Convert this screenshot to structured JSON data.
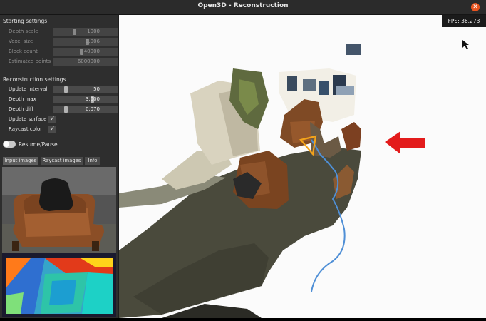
{
  "window": {
    "title": "Open3D - Reconstruction"
  },
  "starting_settings": {
    "heading": "Starting settings",
    "rows": [
      {
        "label": "Depth scale",
        "value": "1000",
        "handle": 0.3
      },
      {
        "label": "Voxel size",
        "value": "0.006",
        "handle": 0.48
      },
      {
        "label": "Block count",
        "value": "40000",
        "handle": 0.4
      },
      {
        "label": "Estimated points",
        "value": "6000000",
        "handle": 0.98
      }
    ]
  },
  "reconstruction_settings": {
    "heading": "Reconstruction settings",
    "sliders": [
      {
        "label": "Update interval",
        "value": "50",
        "handle": 0.18
      },
      {
        "label": "Depth max",
        "value": "3.000",
        "handle": 0.55
      },
      {
        "label": "Depth diff",
        "value": "0.070",
        "handle": 0.18
      }
    ],
    "checks": [
      {
        "label": "Update surface",
        "checked": true
      },
      {
        "label": "Raycast color",
        "checked": true
      }
    ]
  },
  "resume": {
    "label": "Resume/Pause"
  },
  "tabs": [
    "Input images",
    "Raycast images",
    "Info"
  ],
  "fps": "FPS: 36.273",
  "colors": {
    "accent_close": "#e9541f",
    "arrow": "#e31b1b",
    "trajectory": "#4f8fd6",
    "camera": "#f2a31b"
  }
}
